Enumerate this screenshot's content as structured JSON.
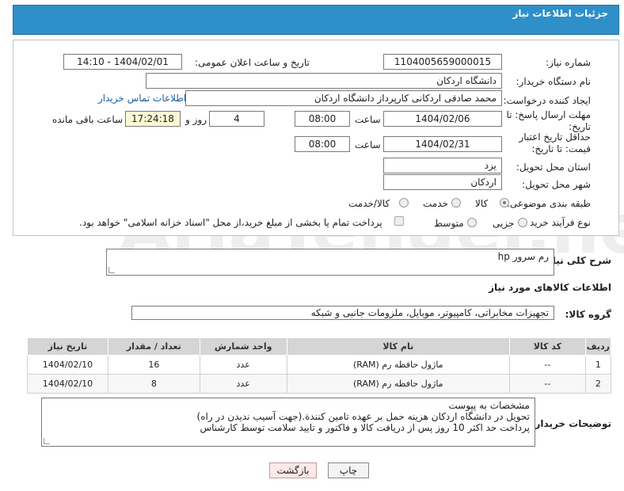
{
  "header": {
    "title": "جزئیات اطلاعات نیاز"
  },
  "form": {
    "need_number_label": "شماره نیاز:",
    "need_number": "1104005659000015",
    "announce_label": "تاریخ و ساعت اعلان عمومی:",
    "announce_value": "1404/02/01 - 14:10",
    "buyer_org_label": "نام دستگاه خریدار:",
    "buyer_org": "دانشگاه اردکان",
    "requester_label": "ایجاد کننده درخواست:",
    "requester": "محمد صادقی اردکانی کارپرداز دانشگاه اردکان",
    "contact_link": "اطلاعات تماس خریدار",
    "deadline_label": "مهلت ارسال پاسخ: تا تاریخ:",
    "deadline_date": "1404/02/06",
    "time_label": "ساعت",
    "deadline_time": "08:00",
    "days_value": "4",
    "days_label": "روز و",
    "remaining_time": "17:24:18",
    "remaining_label": "ساعت باقی مانده",
    "price_validity_label": "حداقل تاریخ اعتبار قیمت: تا تاریخ:",
    "price_validity_date": "1404/02/31",
    "price_validity_time": "08:00",
    "province_label": "استان محل تحویل:",
    "province": "یزد",
    "city_label": "شهر محل تحویل:",
    "city": "اردکان",
    "category_label": "طبقه بندی موضوعی:",
    "category_options": [
      "کالا",
      "خدمت",
      "کالا/خدمت"
    ],
    "process_label": "نوع فرآیند خرید :",
    "process_options": [
      "جزیی",
      "متوسط"
    ],
    "payment_note": "پرداخت تمام یا بخشی از مبلغ خرید،از محل \"اسناد خزانه اسلامی\" خواهد بود."
  },
  "summary": {
    "label": "شرح کلی نیاز:",
    "value": "رم سرور hp"
  },
  "goods_section": {
    "title": "اطلاعات کالاهای مورد نیاز",
    "group_label": "گروه کالا:",
    "group_value": "تجهیزات مخابراتی، کامپیوتر، موبایل، ملزومات جانبی و شبکه"
  },
  "table": {
    "headers": [
      "ردیف",
      "کد کالا",
      "نام کالا",
      "واحد شمارش",
      "تعداد / مقدار",
      "تاریخ نیاز"
    ],
    "rows": [
      {
        "row": "1",
        "code": "--",
        "name": "ماژول حافظه رم (RAM)",
        "unit": "عدد",
        "qty": "16",
        "date": "1404/02/10"
      },
      {
        "row": "2",
        "code": "--",
        "name": "ماژول حافظه رم (RAM)",
        "unit": "عدد",
        "qty": "8",
        "date": "1404/02/10"
      }
    ]
  },
  "buyer_notes": {
    "label": "توضیحات خریدار:",
    "lines": [
      "مشخصات به پیوست",
      "تحویل در دانشگاه اردکان هزینه حمل بر عهده تامین کنندة.(جهت آسیب ندیدن در راه)",
      "پرداخت حد اکثر 10 روز پس از دریافت کالا و فاکتور و تایید سلامت توسط کارشناس"
    ]
  },
  "buttons": {
    "print": "چاپ",
    "back": "بازگشت"
  },
  "watermark": "AriaTender.net"
}
